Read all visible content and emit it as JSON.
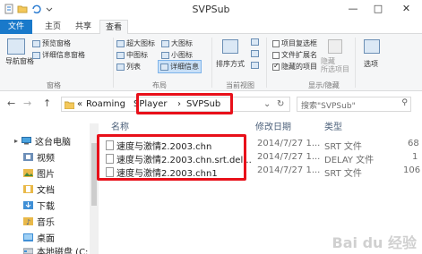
{
  "window": {
    "title": "SVPSub",
    "minimize": "—",
    "maximize": "□",
    "close": "✕"
  },
  "tabs": [
    "文件",
    "主页",
    "共享",
    "查看"
  ],
  "ribbon": {
    "pane": {
      "nav_pane": "导航窗格",
      "preview_pane": "预览窗格",
      "details_pane": "详细信息窗格",
      "label": "窗格"
    },
    "layout": {
      "items": [
        "超大图标",
        "大图标",
        "中图标",
        "小图标",
        "列表",
        "详细信息"
      ],
      "selected": "详细信息",
      "label": "布局"
    },
    "current_view": {
      "sort": "排序方式",
      "label": "当前视图"
    },
    "show_hide": {
      "options": [
        {
          "label": "项目复选框",
          "checked": false
        },
        {
          "label": "文件扩展名",
          "checked": false
        },
        {
          "label": "隐藏的项目",
          "checked": true
        }
      ],
      "hide_selected": "隐藏\n所选项目",
      "label": "显示/隐藏"
    },
    "options_btn": "选项"
  },
  "address": {
    "back": "←",
    "forward": "→",
    "up": "↑",
    "prefix": "«",
    "crumbs": [
      "Roaming",
      "SPlayer",
      "SVPSub"
    ],
    "separator": "›",
    "search_placeholder": "搜索\"SVPSub\""
  },
  "nav": [
    {
      "label": "这台电脑",
      "icon": "computer-icon"
    },
    {
      "label": "视频",
      "icon": "video-folder-icon"
    },
    {
      "label": "图片",
      "icon": "pictures-folder-icon"
    },
    {
      "label": "文档",
      "icon": "documents-folder-icon"
    },
    {
      "label": "下载",
      "icon": "downloads-folder-icon"
    },
    {
      "label": "音乐",
      "icon": "music-folder-icon"
    },
    {
      "label": "桌面",
      "icon": "desktop-folder-icon"
    },
    {
      "label": "本地磁盘 (C:",
      "icon": "drive-icon"
    }
  ],
  "table": {
    "headers": {
      "name": "名称",
      "date": "修改日期",
      "type": "类型"
    },
    "rows": [
      {
        "name": "速度与激情2.2003.chn",
        "date": "2014/7/27 1...",
        "type": "SRT 文件",
        "size": "68"
      },
      {
        "name": "速度与激情2.2003.chn.srt.del...",
        "date": "2014/7/27 1...",
        "type": "DELAY 文件",
        "size": "1"
      },
      {
        "name": "速度与激情2.2003.chn1",
        "date": "2014/7/27 1...",
        "type": "SRT 文件",
        "size": "106"
      }
    ]
  },
  "watermark": "Bai du 经验",
  "colors": {
    "accent": "#1979ca",
    "annotation": "#e8101a"
  }
}
